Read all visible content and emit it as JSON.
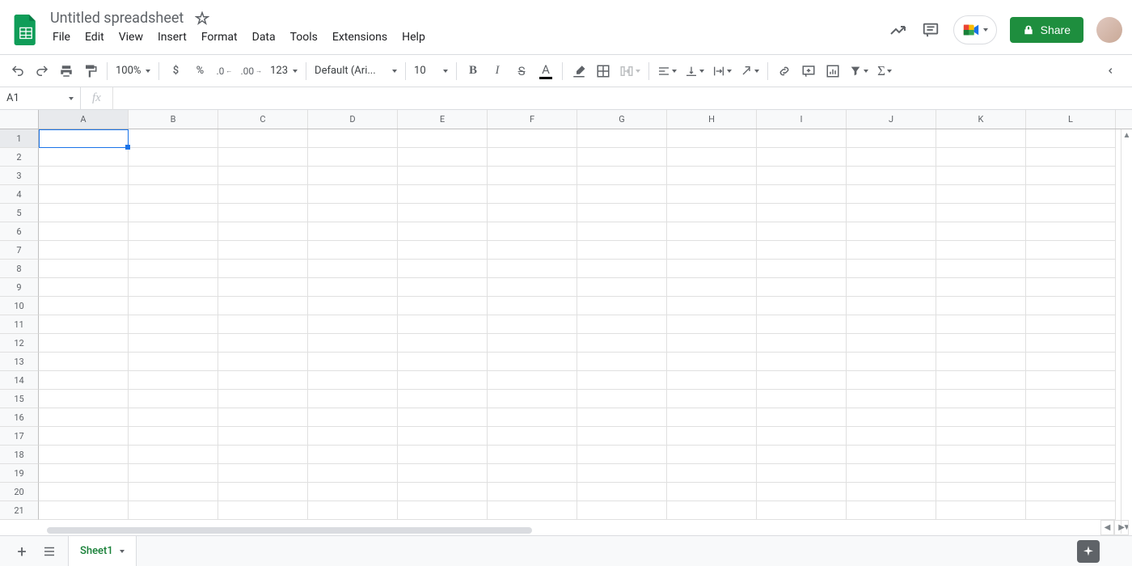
{
  "header": {
    "title": "Untitled spreadsheet",
    "menubar": [
      "File",
      "Edit",
      "View",
      "Insert",
      "Format",
      "Data",
      "Tools",
      "Extensions",
      "Help"
    ],
    "share_label": "Share"
  },
  "toolbar": {
    "zoom": "100%",
    "font": "Default (Ari...",
    "font_size": "10",
    "more_fmt": "123"
  },
  "namebox": {
    "cell_ref": "A1",
    "fx_label": "fx"
  },
  "grid": {
    "columns": [
      "A",
      "B",
      "C",
      "D",
      "E",
      "F",
      "G",
      "H",
      "I",
      "J",
      "K",
      "L"
    ],
    "rows": [
      "1",
      "2",
      "3",
      "4",
      "5",
      "6",
      "7",
      "8",
      "9",
      "10",
      "11",
      "12",
      "13",
      "14",
      "15",
      "16",
      "17",
      "18",
      "19",
      "20",
      "21"
    ],
    "selected_cell": "A1"
  },
  "tabs": {
    "sheet_name": "Sheet1"
  }
}
